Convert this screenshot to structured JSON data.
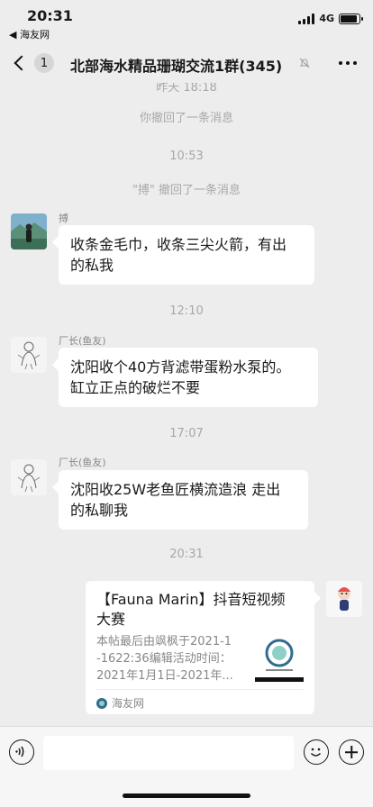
{
  "status": {
    "time": "20:31",
    "back_app": "◀ 海友网",
    "network": "4G",
    "battery_level": 0.9
  },
  "nav": {
    "unread_count": "1",
    "title": "北部海水精品珊瑚交流1群(345)"
  },
  "messages": {
    "partial_time": "昨天 18:18",
    "sys_recall_1": "你撤回了一条消息",
    "time_1": "10:53",
    "sys_recall_2": "\"搏\" 撤回了一条消息",
    "msg1": {
      "sender": "搏",
      "lines": [
        "收条金毛巾，收条三尖火箭，有出",
        "的私我"
      ]
    },
    "time_2": "12:10",
    "msg2": {
      "sender": "厂长(鱼友)",
      "lines": [
        "沈阳收个40方背滤带蛋粉水泵的。",
        "缸立正点的破烂不要"
      ]
    },
    "time_3": "17:07",
    "msg3": {
      "sender": "厂长(鱼友)",
      "lines": [
        "沈阳收25W老鱼匠横流造浪 走出",
        "的私聊我"
      ]
    },
    "time_4": "20:31",
    "card": {
      "title_lines": [
        "【Fauna Marin】抖音短视频",
        "大赛"
      ],
      "desc_lines": [
        "本帖最后由飒枫于2021-1",
        "-1622:36编辑活动时间：",
        "2021年1月1日-2021年..."
      ],
      "source": "海友网"
    }
  },
  "input": {
    "placeholder": ""
  },
  "icons": {
    "voice": "voice-icon",
    "emoji": "emoji-icon",
    "plus": "plus-icon",
    "mute": "mute-bell-icon"
  }
}
